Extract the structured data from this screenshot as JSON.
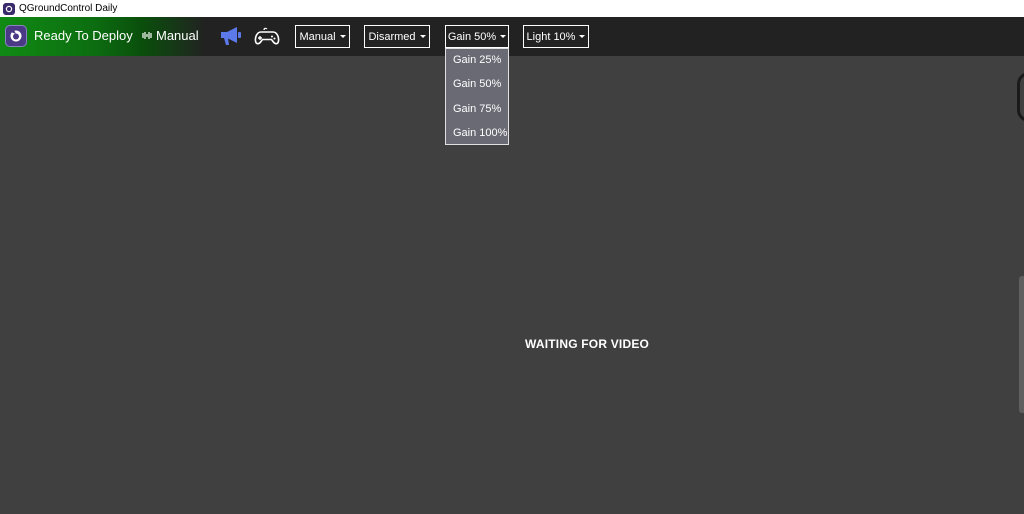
{
  "window": {
    "title": "QGroundControl Daily"
  },
  "toolbar": {
    "status_text": "Ready To Deploy",
    "flight_mode": "Manual",
    "mode_dropdown": "Manual",
    "arm_dropdown": "Disarmed",
    "gain_dropdown": "Gain 50%",
    "light_dropdown": "Light 10%",
    "colors": {
      "status_green": "#118a14",
      "toolbar_bg": "#222222",
      "megaphone_blue": "#5b79e8"
    }
  },
  "gain_menu": {
    "options": [
      "Gain 25%",
      "Gain 50%",
      "Gain 75%",
      "Gain 100%"
    ]
  },
  "video": {
    "message": "WAITING FOR VIDEO"
  },
  "icons": {
    "app": "qgc-app-icon",
    "logo": "qgc-logo-icon",
    "flight_mode": "waveform-icon",
    "messages": "megaphone-icon",
    "joystick": "gamepad-icon",
    "dropdown": "caret-down-icon"
  }
}
